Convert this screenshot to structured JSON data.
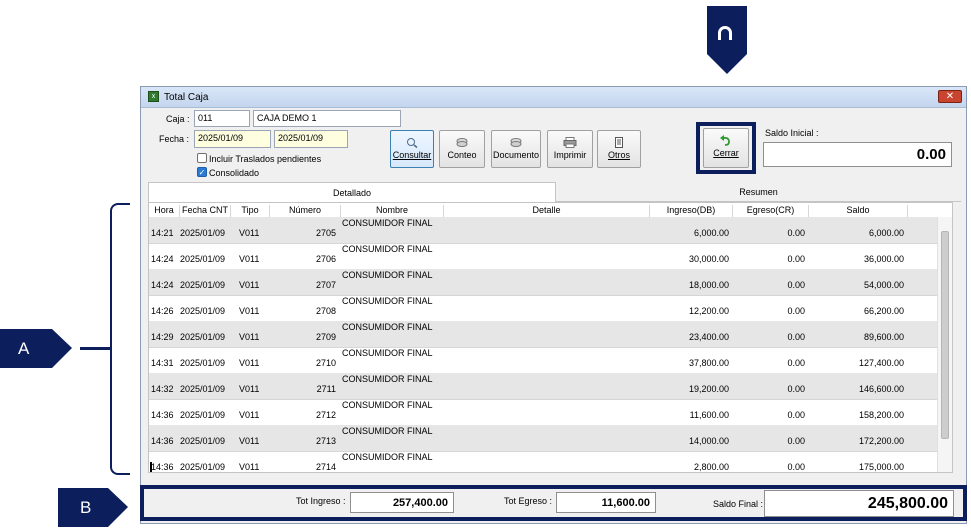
{
  "annotations": {
    "a": "A",
    "b": "B",
    "c": "C"
  },
  "window": {
    "title": "Total Caja",
    "close_label": "✕"
  },
  "form": {
    "caja_label": "Caja :",
    "caja_code": "011",
    "caja_name": "CAJA DEMO 1",
    "fecha_label": "Fecha :",
    "fecha_desde": "2025/01/09",
    "fecha_hasta": "2025/01/09",
    "incluir_label": "Incluir Traslados pendientes",
    "incluir_checked": false,
    "consolidado_label": "Consolidado",
    "consolidado_checked": true
  },
  "toolbar": {
    "consultar": "Consultar",
    "conteo": "Conteo",
    "documento": "Documento",
    "imprimir": "Imprimir",
    "otros": "Otros",
    "cerrar": "Cerrar"
  },
  "saldo_inicial": {
    "label": "Saldo Inicial :",
    "value": "0.00"
  },
  "tabs": {
    "detallado": "Detallado",
    "resumen": "Resumen"
  },
  "table": {
    "headers": [
      "Hora",
      "Fecha CNT",
      "Tipo",
      "Número",
      "Nombre",
      "Detalle",
      "Ingreso(DB)",
      "Egreso(CR)",
      "Saldo"
    ],
    "rows": [
      {
        "hora": "14:21",
        "fecha": "2025/01/09",
        "tipo": "V011",
        "numero": "2705",
        "nombre": "CONSUMIDOR FINAL",
        "detalle": "",
        "ingreso": "6,000.00",
        "egreso": "0.00",
        "saldo": "6,000.00"
      },
      {
        "hora": "14:24",
        "fecha": "2025/01/09",
        "tipo": "V011",
        "numero": "2706",
        "nombre": "CONSUMIDOR FINAL",
        "detalle": "",
        "ingreso": "30,000.00",
        "egreso": "0.00",
        "saldo": "36,000.00"
      },
      {
        "hora": "14:24",
        "fecha": "2025/01/09",
        "tipo": "V011",
        "numero": "2707",
        "nombre": "CONSUMIDOR FINAL",
        "detalle": "",
        "ingreso": "18,000.00",
        "egreso": "0.00",
        "saldo": "54,000.00"
      },
      {
        "hora": "14:26",
        "fecha": "2025/01/09",
        "tipo": "V011",
        "numero": "2708",
        "nombre": "CONSUMIDOR FINAL",
        "detalle": "",
        "ingreso": "12,200.00",
        "egreso": "0.00",
        "saldo": "66,200.00"
      },
      {
        "hora": "14:29",
        "fecha": "2025/01/09",
        "tipo": "V011",
        "numero": "2709",
        "nombre": "CONSUMIDOR FINAL",
        "detalle": "",
        "ingreso": "23,400.00",
        "egreso": "0.00",
        "saldo": "89,600.00"
      },
      {
        "hora": "14:31",
        "fecha": "2025/01/09",
        "tipo": "V011",
        "numero": "2710",
        "nombre": "CONSUMIDOR FINAL",
        "detalle": "",
        "ingreso": "37,800.00",
        "egreso": "0.00",
        "saldo": "127,400.00"
      },
      {
        "hora": "14:32",
        "fecha": "2025/01/09",
        "tipo": "V011",
        "numero": "2711",
        "nombre": "CONSUMIDOR FINAL",
        "detalle": "",
        "ingreso": "19,200.00",
        "egreso": "0.00",
        "saldo": "146,600.00"
      },
      {
        "hora": "14:36",
        "fecha": "2025/01/09",
        "tipo": "V011",
        "numero": "2712",
        "nombre": "CONSUMIDOR FINAL",
        "detalle": "",
        "ingreso": "11,600.00",
        "egreso": "0.00",
        "saldo": "158,200.00"
      },
      {
        "hora": "14:36",
        "fecha": "2025/01/09",
        "tipo": "V011",
        "numero": "2713",
        "nombre": "CONSUMIDOR FINAL",
        "detalle": "",
        "ingreso": "14,000.00",
        "egreso": "0.00",
        "saldo": "172,200.00"
      },
      {
        "hora": "14:36",
        "fecha": "2025/01/09",
        "tipo": "V011",
        "numero": "2714",
        "nombre": "CONSUMIDOR FINAL",
        "detalle": "",
        "ingreso": "2,800.00",
        "egreso": "0.00",
        "saldo": "175,000.00"
      }
    ]
  },
  "totals": {
    "tot_ingreso_label": "Tot Ingreso :",
    "tot_ingreso": "257,400.00",
    "tot_egreso_label": "Tot Egreso :",
    "tot_egreso": "11,600.00",
    "saldo_final_label": "Saldo Final :",
    "saldo_final": "245,800.00"
  },
  "colors": {
    "annotation": "#0c1e5b",
    "row_alt": "#e6e6e6",
    "focus_border": "#3c7fb1"
  }
}
